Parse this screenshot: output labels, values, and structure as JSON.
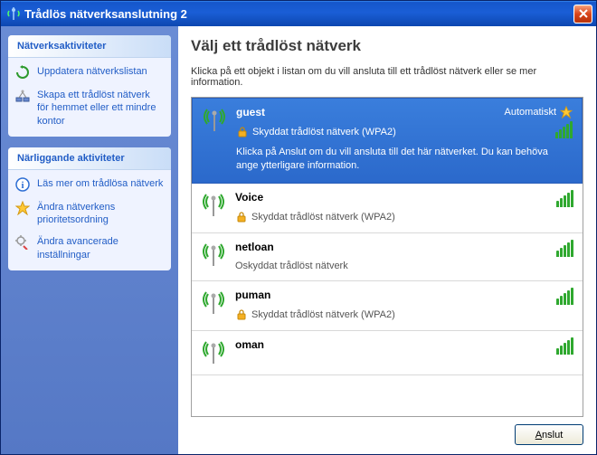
{
  "window": {
    "title": "Trådlös nätverksanslutning 2"
  },
  "sidebar": {
    "panel1": {
      "header": "Nätverksaktiviteter",
      "items": [
        {
          "label": "Uppdatera nätverkslistan"
        },
        {
          "label": "Skapa ett trådlöst nätverk för hemmet eller ett mindre kontor"
        }
      ]
    },
    "panel2": {
      "header": "Närliggande aktiviteter",
      "items": [
        {
          "label": "Läs mer om trådlösa nätverk"
        },
        {
          "label": "Ändra nätverkens prioritetsordning"
        },
        {
          "label": "Ändra avancerade inställningar"
        }
      ]
    }
  },
  "main": {
    "heading": "Välj ett trådlöst nätverk",
    "instruction": "Klicka på ett objekt i listan om du vill ansluta till ett trådlöst nätverk eller se mer information.",
    "connect_label": "Anslut"
  },
  "networks": [
    {
      "name": "guest",
      "security": "Skyddat trådlöst nätverk (WPA2)",
      "auto": "Automatiskt",
      "desc": "Klicka på Anslut om du vill ansluta till det här nätverket. Du kan behöva ange ytterligare information.",
      "signal": 5,
      "locked": true,
      "favorite": true,
      "selected": true
    },
    {
      "name": "Voice",
      "security": "Skyddat trådlöst nätverk (WPA2)",
      "signal": 5,
      "locked": true,
      "selected": false
    },
    {
      "name": "netloan",
      "security": "Oskyddat trådlöst nätverk",
      "signal": 5,
      "locked": false,
      "selected": false
    },
    {
      "name": "puman",
      "security": "Skyddat trådlöst nätverk (WPA2)",
      "signal": 5,
      "locked": true,
      "selected": false
    },
    {
      "name": "oman",
      "security": "",
      "signal": 5,
      "locked": false,
      "selected": false
    }
  ],
  "colors": {
    "signal_green": "#2fa82f",
    "xp_blue": "#215dc6",
    "lock_gold": "#f5b021"
  }
}
